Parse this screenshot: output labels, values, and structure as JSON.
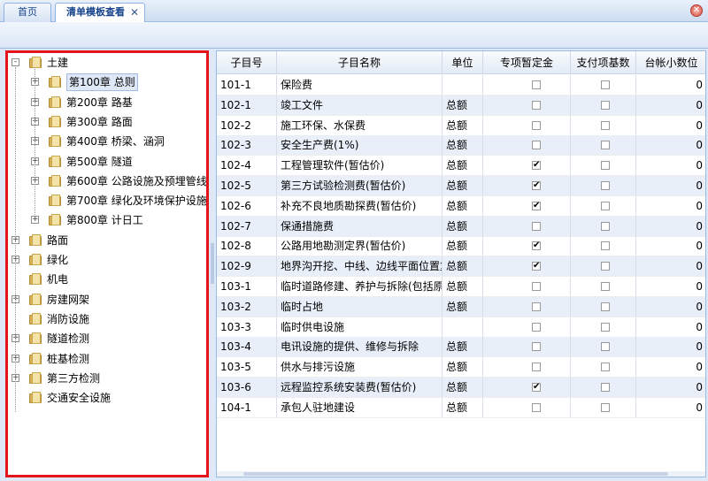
{
  "tabs": [
    {
      "label": "首页"
    },
    {
      "label": "清单模板查看"
    }
  ],
  "tab_close_glyph": "✕",
  "window_close_glyph": "✕",
  "tree": {
    "root": "土建",
    "chapters": [
      "第100章 总则",
      "第200章 路基",
      "第300章 路面",
      "第400章 桥梁、涵洞",
      "第500章 隧道",
      "第600章 公路设施及预埋管线",
      "第700章 绿化及环境保护设施",
      "第800章 计日工"
    ],
    "others": [
      "路面",
      "绿化",
      "机电",
      "房建网架",
      "消防设施",
      "隧道检测",
      "桩基检测",
      "第三方检测",
      "交通安全设施"
    ]
  },
  "grid": {
    "columns": [
      "子目号",
      "子目名称",
      "单位",
      "专项暂定金",
      "支付项基数",
      "台帐小数位"
    ],
    "rows": [
      {
        "id": "101-1",
        "name": "保险费",
        "unit": "",
        "special": false,
        "base": false,
        "decimals": "0"
      },
      {
        "id": "102-1",
        "name": "竣工文件",
        "unit": "总额",
        "special": false,
        "base": false,
        "decimals": "0"
      },
      {
        "id": "102-2",
        "name": "施工环保、水保费",
        "unit": "总额",
        "special": false,
        "base": false,
        "decimals": "0"
      },
      {
        "id": "102-3",
        "name": "安全生产费(1%)",
        "unit": "总额",
        "special": false,
        "base": false,
        "decimals": "0"
      },
      {
        "id": "102-4",
        "name": "工程管理软件(暂估价)",
        "unit": "总额",
        "special": true,
        "base": false,
        "decimals": "0"
      },
      {
        "id": "102-5",
        "name": "第三方试验检测费(暂估价)",
        "unit": "总额",
        "special": true,
        "base": false,
        "decimals": "0"
      },
      {
        "id": "102-6",
        "name": "补充不良地质勘探费(暂估价)",
        "unit": "总额",
        "special": true,
        "base": false,
        "decimals": "0"
      },
      {
        "id": "102-7",
        "name": "保通措施费",
        "unit": "总额",
        "special": false,
        "base": false,
        "decimals": "0"
      },
      {
        "id": "102-8",
        "name": "公路用地勘测定界(暂估价)",
        "unit": "总额",
        "special": true,
        "base": false,
        "decimals": "0"
      },
      {
        "id": "102-9",
        "name": "地界沟开挖、中线、边线平面位置复",
        "unit": "总额",
        "special": true,
        "base": false,
        "decimals": "0"
      },
      {
        "id": "103-1",
        "name": "临时道路修建、养护与拆除(包括原道",
        "unit": "总额",
        "special": false,
        "base": false,
        "decimals": "0"
      },
      {
        "id": "103-2",
        "name": "临时占地",
        "unit": "总额",
        "special": false,
        "base": false,
        "decimals": "0"
      },
      {
        "id": "103-3",
        "name": "临时供电设施",
        "unit": "",
        "special": false,
        "base": false,
        "decimals": "0"
      },
      {
        "id": "103-4",
        "name": "电讯设施的提供、维修与拆除",
        "unit": "总额",
        "special": false,
        "base": false,
        "decimals": "0"
      },
      {
        "id": "103-5",
        "name": "供水与排污设施",
        "unit": "总额",
        "special": false,
        "base": false,
        "decimals": "0"
      },
      {
        "id": "103-6",
        "name": "远程监控系统安装费(暂估价)",
        "unit": "总额",
        "special": true,
        "base": false,
        "decimals": "0"
      },
      {
        "id": "104-1",
        "name": "承包人驻地建设",
        "unit": "总额",
        "special": false,
        "base": false,
        "decimals": "0"
      }
    ]
  },
  "check_glyph": "✔"
}
